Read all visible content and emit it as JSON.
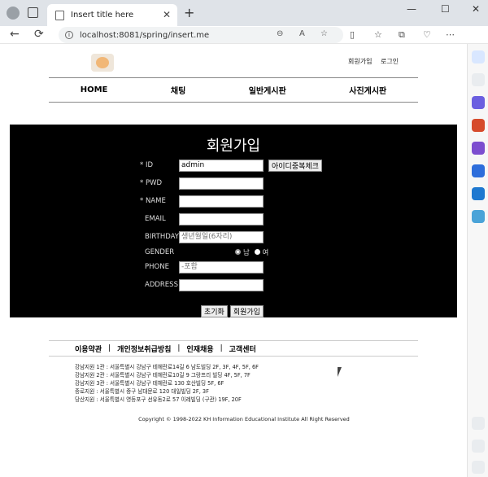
{
  "browser": {
    "tab_title": "Insert title here",
    "close_tab": "✕",
    "new_tab": "+",
    "minimize": "—",
    "maximize": "☐",
    "close": "✕",
    "back": "←",
    "reload": "⟳",
    "url": "localhost:8081/spring/insert.me"
  },
  "page": {
    "top_links": [
      "회원가입",
      "로그인"
    ],
    "menu": [
      "HOME",
      "채팅",
      "일반게시판",
      "사진게시판"
    ],
    "form": {
      "title": "회원가입",
      "id_label": "* ID",
      "id_value": "admin",
      "id_check_button": "아이디중복체크",
      "pwd_label": "* PWD",
      "name_label": "* NAME",
      "email_label": "EMAIL",
      "birthday_label": "BIRTHDAY",
      "birthday_placeholder": "생년월일(6자리)",
      "gender_label": "GENDER",
      "gender_options": [
        "남",
        "여"
      ],
      "phone_label": "PHONE",
      "phone_placeholder": "-포함",
      "address_label": "ADDRESS",
      "reset_button": "초기화",
      "submit_button": "회원가입"
    },
    "footer_links": [
      "이용약관",
      "개인정보취급방침",
      "인재채용",
      "고객센터"
    ],
    "branches": [
      "강남지원 1관 : 서울특별시 강남구 테헤란로14길 6 남도빌딩 2F, 3F, 4F, 5F, 6F",
      "강남지원 2관 : 서울특별시 강남구 테헤란로10길 9 그랑프리 빌딩 4F, 5F, 7F",
      "강남지원 3관 : 서울특별시 강남구 테헤란로 130 호산빌딩 5F, 6F",
      "종로지원 : 서울특별시 중구 남대문로 120 대일빌딩 2F, 3F",
      "당산지원 : 서울특별시 영등포구 선유동2로 57 이레빌딩 (구관) 19F, 20F"
    ],
    "copyright": "Copyright © 1998-2022 KH Information Educational Institute All Right Reserved"
  }
}
